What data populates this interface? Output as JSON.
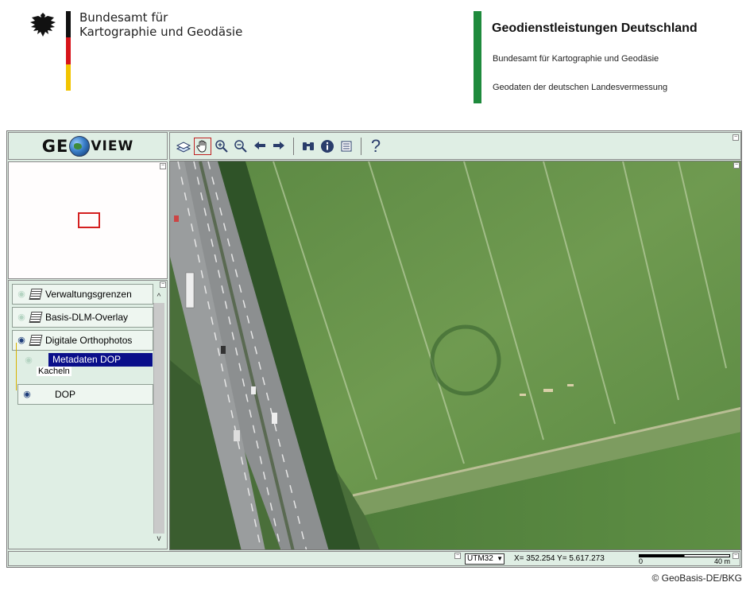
{
  "header": {
    "agency_line1": "Bundesamt für",
    "agency_line2": "Kartographie und Geodäsie",
    "service_title": "Geodienstleistungen Deutschland",
    "service_sub1": "Bundesamt für Kartographie und Geodäsie",
    "service_sub2": "Geodaten der deutschen Landesvermessung"
  },
  "app": {
    "logo_g": "GE",
    "logo_view": "VIEW",
    "toolbar": {
      "help_label": "?"
    }
  },
  "layers": {
    "items": [
      {
        "label": "Verwaltungsgrenzen",
        "visible": false
      },
      {
        "label": "Basis-DLM-Overlay",
        "visible": false
      },
      {
        "label": "Digitale Orthophotos",
        "visible": true
      }
    ],
    "metadata_label": "Metadaten DOP",
    "tiles_label": "Kacheln",
    "dop_label": "DOP"
  },
  "statusbar": {
    "crs": "UTM32",
    "coords": "X= 352.254  Y= 5.617.273",
    "scale_start": "0",
    "scale_end": "40 m"
  },
  "copyright": "© GeoBasis-DE/BKG",
  "colors": {
    "panel_bg": "#dfeee4",
    "selection": "#0a0f8a",
    "green_accent": "#1e8a3c"
  }
}
